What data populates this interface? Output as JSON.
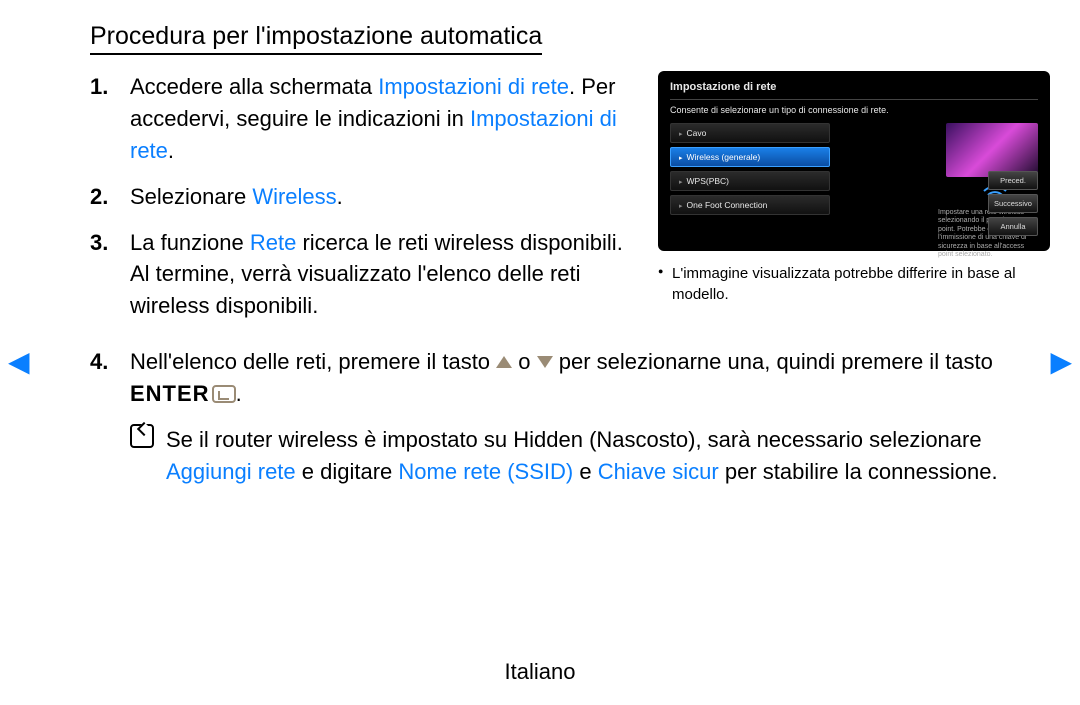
{
  "title": "Procedura per l'impostazione automatica",
  "steps": {
    "s1": {
      "num": "1.",
      "t1": "Accedere alla schermata ",
      "kw1": "Impostazioni di rete",
      "t2": ". Per accedervi, seguire le indicazioni in ",
      "kw2": "Impostazioni di rete",
      "t3": "."
    },
    "s2": {
      "num": "2.",
      "t1": "Selezionare ",
      "kw1": "Wireless",
      "t2": "."
    },
    "s3": {
      "num": "3.",
      "t1": "La funzione ",
      "kw1": "Rete",
      "t2": " ricerca le reti wireless disponibili. Al termine, verrà visualizzato l'elenco delle reti wireless disponibili."
    },
    "s4": {
      "num": "4.",
      "t1": "Nell'elenco delle reti, premere il tasto ",
      "t2": " o ",
      "t3": " per selezionarne una, quindi premere il tasto ",
      "enter": "ENTER",
      "t4": "."
    },
    "note": {
      "t1": "Se il router wireless è impostato su Hidden (Nascosto), sarà necessario selezionare ",
      "kw1": "Aggiungi rete",
      "t2": " e digitare ",
      "kw2": "Nome rete (SSID)",
      "t3": " e ",
      "kw3": "Chiave sicur",
      "t4": " per stabilire la connessione."
    }
  },
  "tv": {
    "title": "Impostazione di rete",
    "sub": "Consente di selezionare un tipo di connessione di rete.",
    "items": [
      "Cavo",
      "Wireless (generale)",
      "WPS(PBC)",
      "One Foot Connection"
    ],
    "help": "Impostare una rete wireless selezionando il proprio access point. Potrebbe essere richiesta l'immissione di una chiave di sicurezza in base all'access point selezionato.",
    "btns": [
      "Preced.",
      "Successivo",
      "Annulla"
    ]
  },
  "caption": "L'immagine visualizzata potrebbe differire in base al modello.",
  "footer": "Italiano"
}
